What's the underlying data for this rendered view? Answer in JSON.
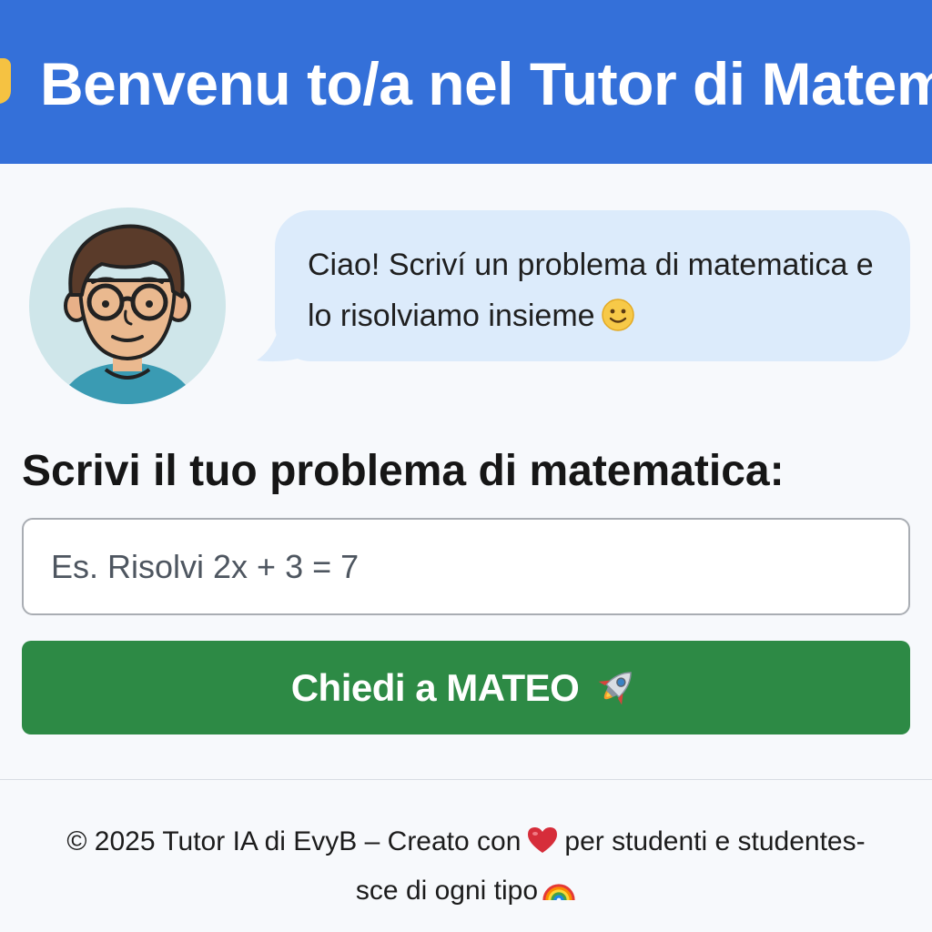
{
  "header": {
    "title": "Benvenu to/a nel Tutor di Matematica",
    "icon": "book-icon",
    "background": "#3470d9"
  },
  "tutor": {
    "avatar": "tutor-avatar",
    "message": "Ciao! Scriví un problema di matematica e lo risolviamo insieme",
    "message_icon": "smiley-icon"
  },
  "form": {
    "label": "Scrivi il tuo problema di matematica:",
    "input_value": "",
    "input_placeholder": "Es. Risolvi 2x + 3 = 7",
    "button_label": "Chiedi a MATEO",
    "button_icon": "rocket-icon",
    "button_color": "#2d8a45"
  },
  "footer": {
    "text_before_icon": "© 2025 Tutor IA di EvyB – Creato con",
    "icon": "heart-icon",
    "text_after_icon": "per studenti e studentes-",
    "text_line2": "sce di ogni tipo",
    "line2_icon": "rainbow-icon"
  }
}
